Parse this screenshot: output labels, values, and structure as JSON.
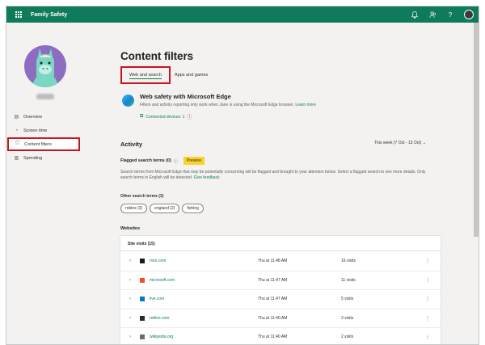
{
  "app": {
    "title": "Family Safety"
  },
  "colors": {
    "brand": "#0f7b5b",
    "highlight": "#c5161d",
    "preview": "#f8d32a",
    "avatar_bg": "#8d6cc2"
  },
  "topbar_icons": [
    "bell-icon",
    "people-icon",
    "help-icon",
    "user-avatar"
  ],
  "topbar": {
    "help_label": "?"
  },
  "sidebar": {
    "items": [
      {
        "label": "Overview",
        "icon": "overview-icon"
      },
      {
        "label": "Screen time",
        "icon": "screen-time-icon"
      },
      {
        "label": "Content filters",
        "icon": "shield-icon",
        "active": true
      },
      {
        "label": "Spending",
        "icon": "spending-icon"
      }
    ]
  },
  "main": {
    "title": "Content filters",
    "tabs": [
      {
        "label": "Web and search",
        "active": true
      },
      {
        "label": "Apps and games",
        "active": false
      }
    ],
    "edge": {
      "title": "Web safety with Microsoft Edge",
      "description": "Filters and activity reporting only work when Jane is using the Microsoft Edge browser.",
      "learn_more": "Learn more",
      "connected": "Connected devices: 1"
    },
    "activity": {
      "title": "Activity",
      "range": "This week (7 Oct - 13 Oct)",
      "flagged_label": "Flagged search terms (0)",
      "preview_badge": "Preview",
      "flagged_desc": "Search terms from Microsoft Edge that may be potentially concerning will be flagged and brought to your attention below. Select a flagged search to see more details. Only search terms in English will be detected.",
      "give_feedback": "Give feedback",
      "other_terms_label": "Other search terms (3)",
      "other_terms": [
        "roblox (3)",
        "england (2)",
        "fishing"
      ]
    },
    "websites": {
      "title": "Websites",
      "site_visits_label": "Site visits (15)",
      "rows": [
        {
          "site": "msn.com",
          "time": "Thu at 11:48 AM",
          "visits": "16 visits",
          "favicon": "msn-icon",
          "color": "#1a1a1a"
        },
        {
          "site": "microsoft.com",
          "time": "Thu at 11:47 AM",
          "visits": "11 visits",
          "favicon": "microsoft-icon",
          "color": "#f25022"
        },
        {
          "site": "live.com",
          "time": "Thu at 11:47 AM",
          "visits": "5 visits",
          "favicon": "live-icon",
          "color": "#0078d4"
        },
        {
          "site": "roblox.com",
          "time": "Thu at 11:40 AM",
          "visits": "3 visits",
          "favicon": "roblox-icon",
          "color": "#2b2b2b"
        },
        {
          "site": "wikipedia.org",
          "time": "Thu at 11:40 AM",
          "visits": "2 visits",
          "favicon": "wikipedia-icon",
          "color": "#6b6b6b"
        }
      ]
    }
  }
}
